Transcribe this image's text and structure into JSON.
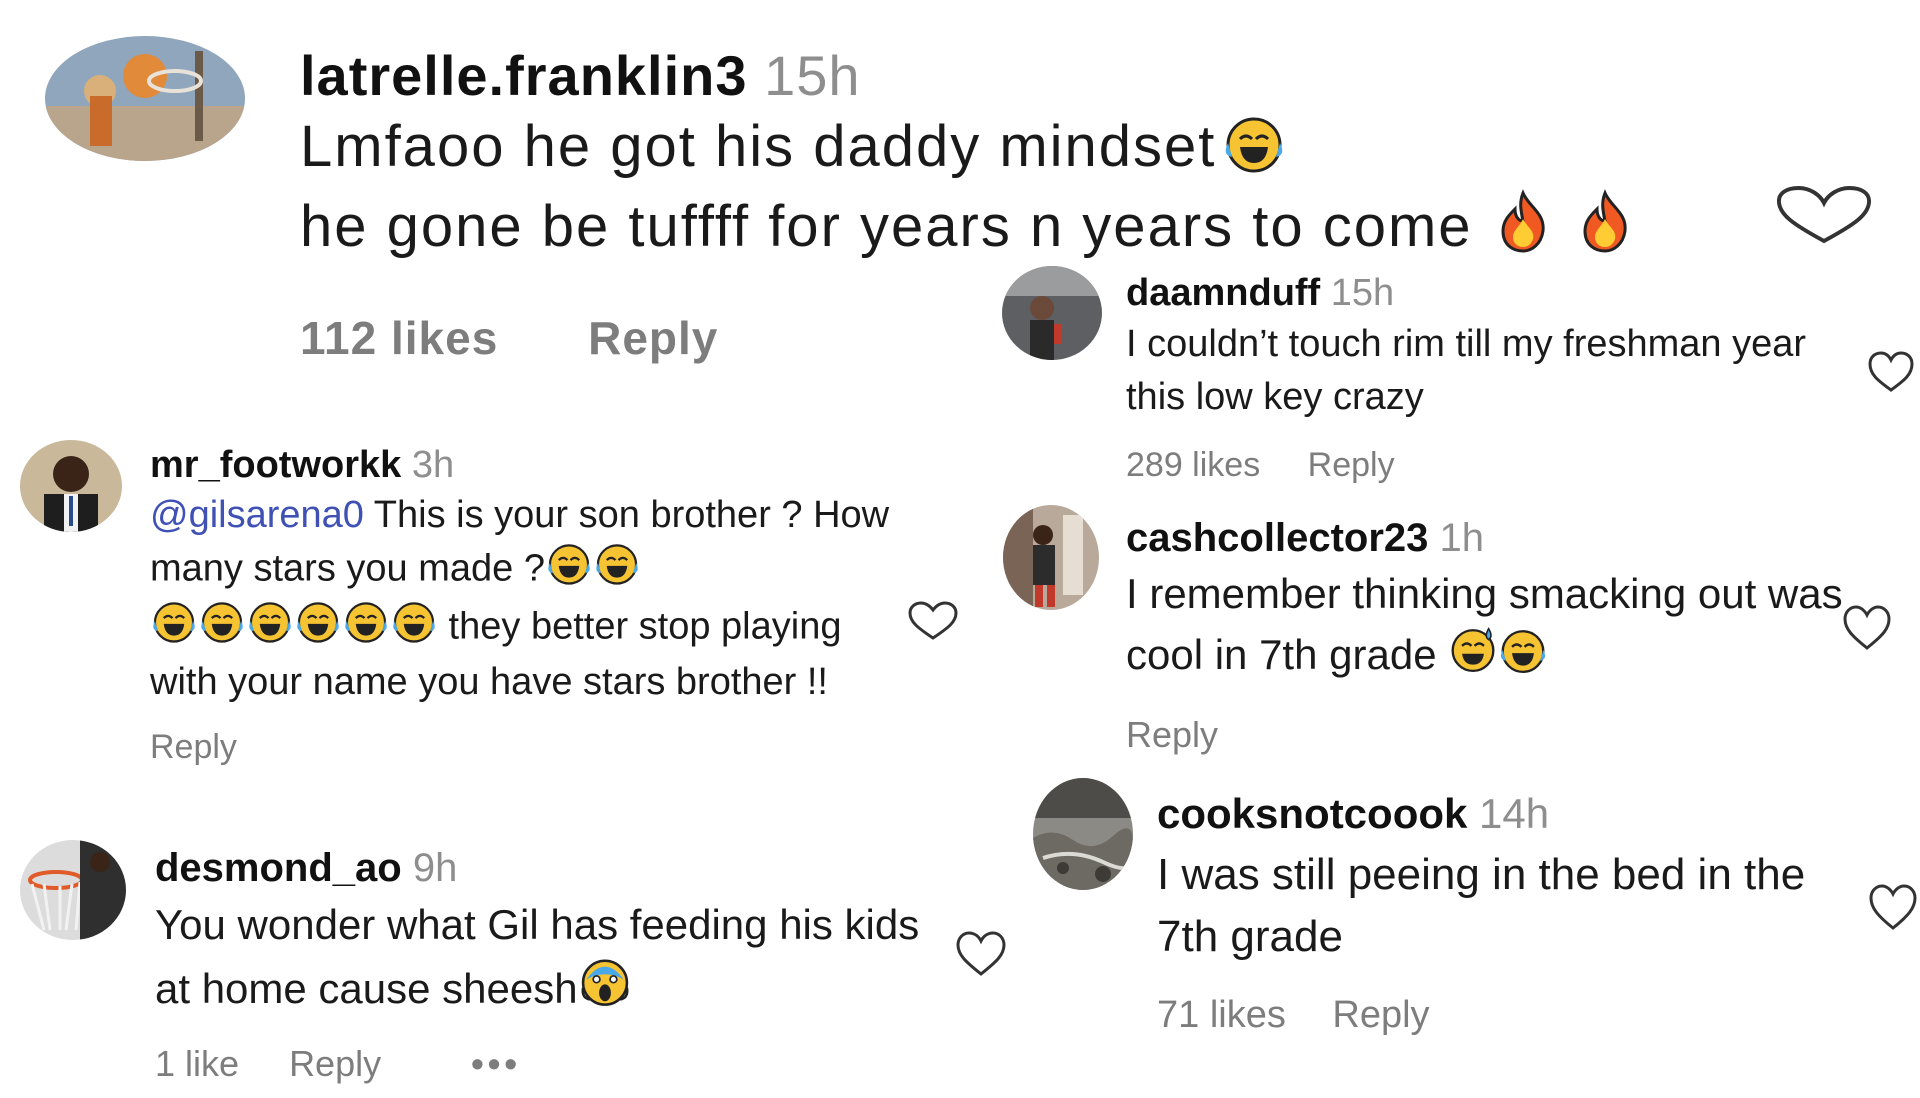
{
  "colors": {
    "text": "#1a1a1a",
    "muted": "#8e8e8e",
    "mention": "#3f51b5",
    "background": "#ffffff"
  },
  "comments": [
    {
      "username": "latrelle.franklin3",
      "time": "15h",
      "text_1": "Lmfaoo he got his daddy mindset",
      "text_2": "he gone be tuffff for years n years to come",
      "likes": "112 likes",
      "reply": "Reply",
      "emojis": [
        "tears-of-joy-emoji",
        "fire-emoji",
        "fire-emoji"
      ]
    },
    {
      "username": "daamnduff",
      "time": "15h",
      "text": "I couldn’t touch rim till my freshman year this low key crazy",
      "likes": "289 likes",
      "reply": "Reply"
    },
    {
      "username": "mr_footworkk",
      "time": "3h",
      "mention": "@gilsarena0",
      "text_1": " This is your son brother ? How many stars you made ?",
      "text_2": " they better stop playing with your name you have stars brother !!",
      "reply": "Reply",
      "emojis": [
        "tears-of-joy-emoji",
        "tears-of-joy-emoji",
        "tears-of-joy-emoji",
        "tears-of-joy-emoji",
        "tears-of-joy-emoji",
        "tears-of-joy-emoji",
        "tears-of-joy-emoji",
        "tears-of-joy-emoji"
      ]
    },
    {
      "username": "cashcollector23",
      "time": "1h",
      "text": "I remember thinking smacking out was cool in 7th grade",
      "reply": "Reply",
      "emojis": [
        "sweat-smile-emoji",
        "tears-of-joy-emoji"
      ]
    },
    {
      "username": "desmond_ao",
      "time": "9h",
      "text": "You wonder what Gil has feeding his kids at home cause sheesh",
      "likes": "1 like",
      "reply": "Reply",
      "more": "•••",
      "emojis": [
        "screaming-face-emoji"
      ]
    },
    {
      "username": "cooksnotcoook",
      "time": "14h",
      "text": "I was still peeing in the bed in the 7th grade",
      "likes": "71 likes",
      "reply": "Reply"
    }
  ]
}
